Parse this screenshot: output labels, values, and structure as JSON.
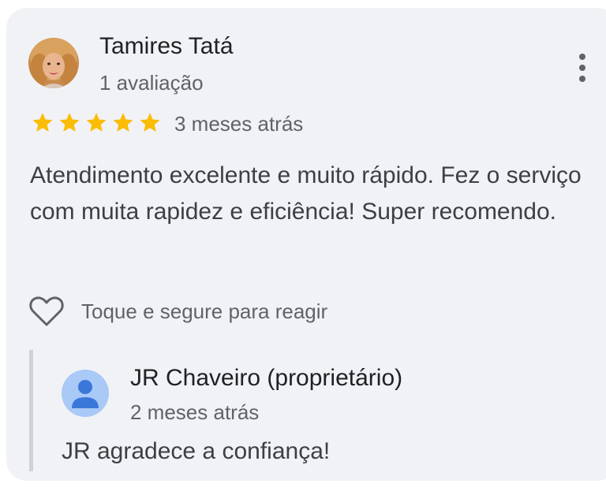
{
  "review": {
    "author_name": "Tamires Tatá",
    "author_reviews": "1 avaliação",
    "rating": 5,
    "rating_max": 5,
    "time": "3 meses atrás",
    "text": "Atendimento excelente e muito rápido. Fez o serviço com muita rapidez e eficiência! Super recomendo.",
    "react_label": "Toque e segure para reagir",
    "icons": {
      "menu": "more-vert-icon",
      "star": "star-icon",
      "react": "heart-outline-icon"
    }
  },
  "owner_reply": {
    "name": "JR Chaveiro (proprietário)",
    "time": "2 meses atrás",
    "text": "JR agradece a confiança!",
    "icon": "person-icon"
  },
  "colors": {
    "card_background": "#f1f2f5",
    "star": "#fbbc04",
    "owner_avatar": "#a9c9f7",
    "owner_avatar_icon": "#3b77d9"
  }
}
